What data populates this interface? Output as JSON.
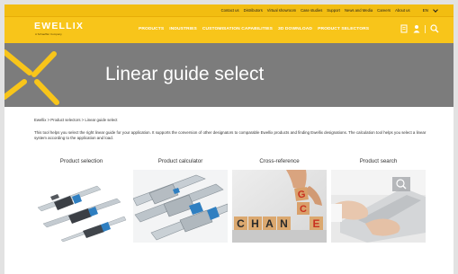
{
  "topbar": {
    "links": [
      "Contact us",
      "Distributors",
      "Virtual showroom",
      "Case studies",
      "Support",
      "News and Media",
      "Careers",
      "About us"
    ],
    "language": "EN"
  },
  "brand": {
    "name": "EWELLIX",
    "tagline": "A Schaeffler Company"
  },
  "nav": {
    "items": [
      "PRODUCTS",
      "INDUSTRIES",
      "CUSTOMISATION CAPABILITIES",
      "3D DOWNLOAD",
      "PRODUCT SELECTORS"
    ]
  },
  "hero": {
    "title": "Linear guide select"
  },
  "breadcrumb": "Ewellix > Product selectors > Linear guide select",
  "intro": "This tool helps you select the right linear guide for your application. It supports the conversion of other designators to comparable Ewellix products and finding Ewellix designations. The calculation tool helps you select a linear system according to the application and load.",
  "cards": [
    {
      "title": "Product selection"
    },
    {
      "title": "Product calculator"
    },
    {
      "title": "Cross-reference"
    },
    {
      "title": "Product search"
    }
  ],
  "crossref_blocks": [
    "C",
    "H",
    "A",
    "N",
    "C",
    "G",
    "E"
  ],
  "colors": {
    "brand_yellow": "#f8c51a",
    "hero_gray": "#7c7c7c"
  }
}
